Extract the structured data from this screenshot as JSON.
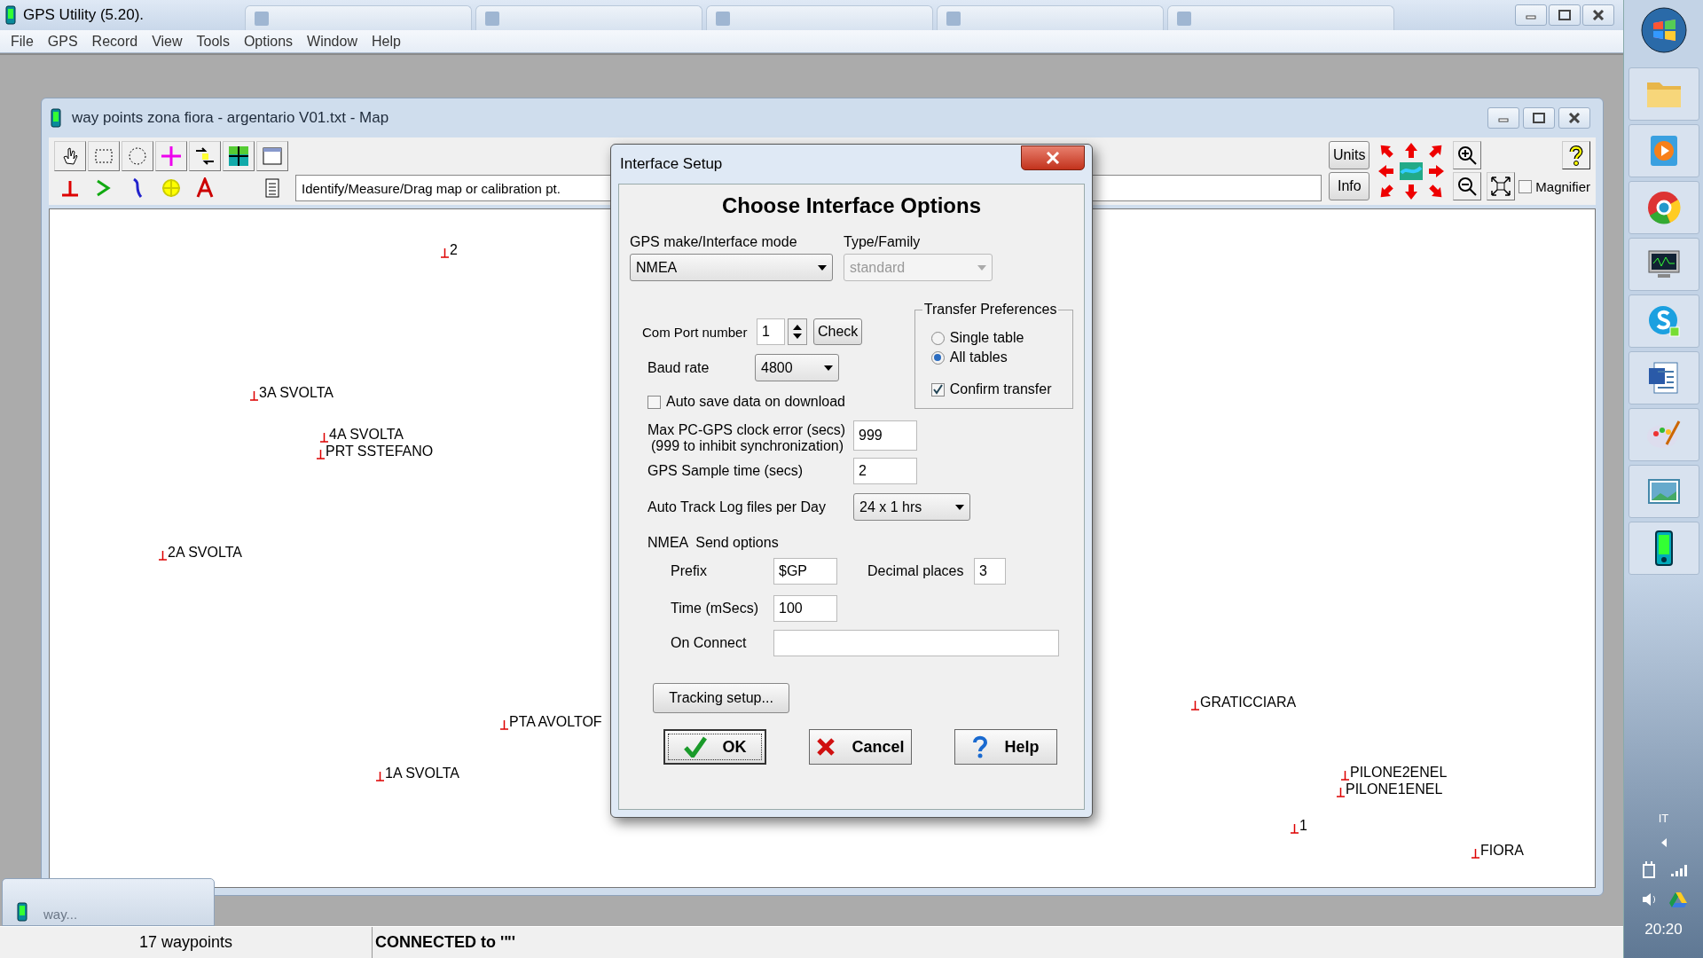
{
  "app_window": {
    "title": "GPS Utility (5.20).",
    "menu": [
      "File",
      "GPS",
      "Record",
      "View",
      "Tools",
      "Options",
      "Window",
      "Help"
    ]
  },
  "map_window": {
    "title": "way points zona fiora - argentario V01.txt - Map",
    "mode_hint": "Identify/Measure/Drag map or calibration pt.",
    "side_buttons": [
      "Units",
      "Info"
    ],
    "magnifier": {
      "label": "Magnifier",
      "checked": false
    },
    "waypoints": [
      {
        "name": "2"
      },
      {
        "name": "3A SVOLTA"
      },
      {
        "name": "4A SVOLTA"
      },
      {
        "name": "PRT SSTEFANO"
      },
      {
        "name": "2A SVOLTA"
      },
      {
        "name": "PTA AVOLTOF"
      },
      {
        "name": "1A SVOLTA"
      },
      {
        "name": "GRATICCIARA"
      },
      {
        "name": "PILONE2ENEL"
      },
      {
        "name": "PILONE1ENEL"
      },
      {
        "name": "1"
      },
      {
        "name": "FIORA"
      }
    ]
  },
  "dialog": {
    "title": "Interface Setup",
    "heading": "Choose Interface Options",
    "gps_mode": {
      "label": "GPS make/Interface mode",
      "value": "NMEA"
    },
    "type_family": {
      "label": "Type/Family",
      "value": "standard",
      "disabled": true
    },
    "com_port": {
      "label": "Com Port number",
      "value": "1",
      "button": "Check"
    },
    "baud_rate": {
      "label": "Baud rate",
      "value": "4800"
    },
    "auto_save": {
      "label": "Auto save data on download",
      "checked": false
    },
    "transfer_preferences": {
      "title": "Transfer Preferences",
      "options": [
        {
          "label": "Single table",
          "selected": false
        },
        {
          "label": "All tables",
          "selected": true
        }
      ],
      "confirm_transfer": {
        "label": "Confirm transfer",
        "checked": true
      }
    },
    "clock_error": {
      "label": "Max PC-GPS clock error (secs)",
      "note": "(999 to inhibit synchronization)",
      "value": "999"
    },
    "sample_time": {
      "label": "GPS Sample time (secs)",
      "value": "2"
    },
    "track_log": {
      "label": "Auto Track Log files per Day",
      "value": "24 x 1 hrs"
    },
    "nmea": {
      "title": "NMEA  Send options",
      "prefix": {
        "label": "Prefix",
        "value": "$GP"
      },
      "decimal_places": {
        "label": "Decimal places",
        "value": "3"
      },
      "time": {
        "label": "Time (mSecs)",
        "value": "100"
      },
      "on_connect": {
        "label": "On Connect"
      }
    },
    "tracking_button": "Tracking setup...",
    "buttons": [
      {
        "kind": "ok",
        "label": "OK",
        "focused": true
      },
      {
        "kind": "cancel",
        "label": "Cancel",
        "focused": false
      },
      {
        "kind": "help",
        "label": "Help",
        "focused": false
      }
    ]
  },
  "minimized_window": {
    "title": "way..."
  },
  "status_bar": [
    "17 waypoints",
    "CONNECTED to '\"'"
  ],
  "taskbar": {
    "language": "IT",
    "clock": "20:20"
  }
}
